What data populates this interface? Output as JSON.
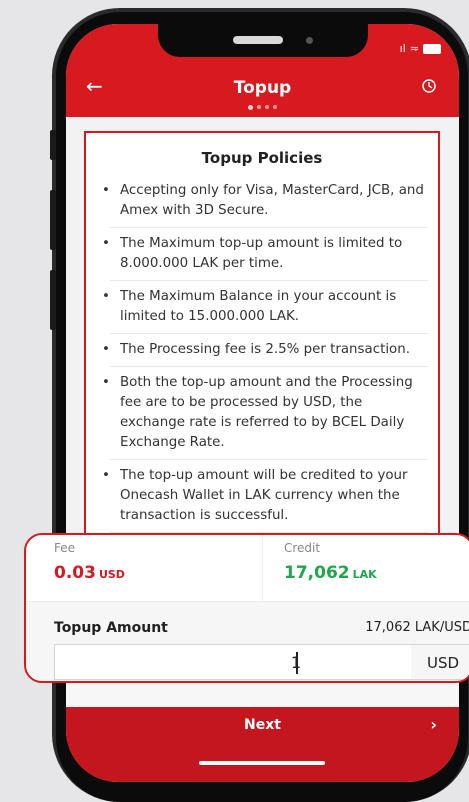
{
  "header": {
    "title": "Topup",
    "back_icon": "←",
    "history_icon": "history-icon"
  },
  "policies": {
    "title": "Topup Policies",
    "items": [
      "Accepting only for Visa, MasterCard, JCB, and Amex with 3D Secure.",
      "The Maximum top-up amount is limited to 8.000.000 LAK per time.",
      "The Maximum Balance in your account is limited to 15.000.000 LAK.",
      "The Processing fee is 2.5% per transaction.",
      "Both the top-up amount and the Processing fee are to be processed by USD, the exchange rate is referred to by BCEL Daily Exchange Rate.",
      "The top-up amount will be credited to your Onecash Wallet in LAK currency when the transaction is successful."
    ]
  },
  "summary": {
    "fee_label": "Fee",
    "fee_value": "0.03",
    "fee_unit": "USD",
    "credit_label": "Credit",
    "credit_value": "17,062",
    "credit_unit": "LAK"
  },
  "amount": {
    "label": "Topup Amount",
    "rate": "17,062 LAK/USD",
    "value": "1",
    "currency": "USD"
  },
  "footer": {
    "next_label": "Next",
    "next_arrow": "›"
  },
  "colors": {
    "brand": "#d71920",
    "credit": "#1fa64a"
  }
}
